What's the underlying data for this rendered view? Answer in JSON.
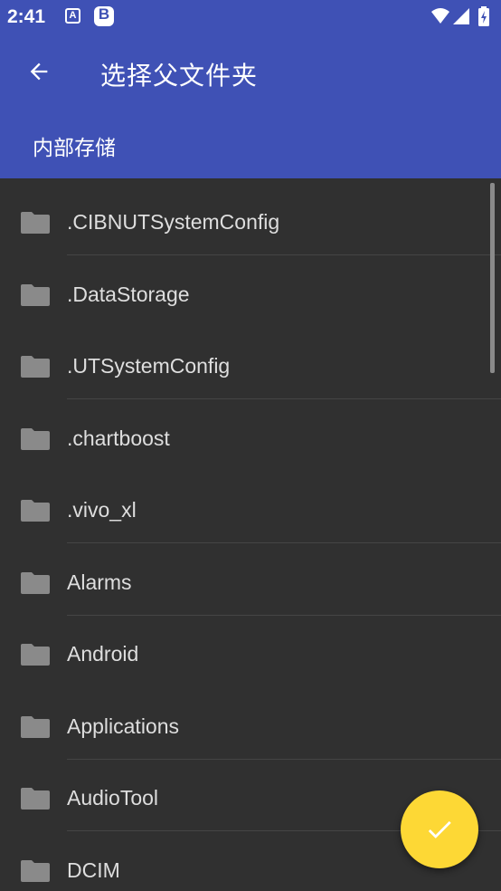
{
  "status_bar": {
    "time": "2:41",
    "notification_icons": [
      "A",
      "B"
    ]
  },
  "toolbar": {
    "back_icon": "arrow-back-icon",
    "title": "选择父文件夹"
  },
  "breadcrumb": "内部存储",
  "folders": [
    ".CIBNUTSystemConfig",
    ".DataStorage",
    ".UTSystemConfig",
    ".chartboost",
    ".vivo_xl",
    "Alarms",
    "Android",
    "Applications",
    "AudioTool",
    "DCIM"
  ],
  "fab": {
    "icon": "check-icon"
  },
  "colors": {
    "header": "#3f51b5",
    "background": "#303030",
    "fab": "#fdd835"
  }
}
